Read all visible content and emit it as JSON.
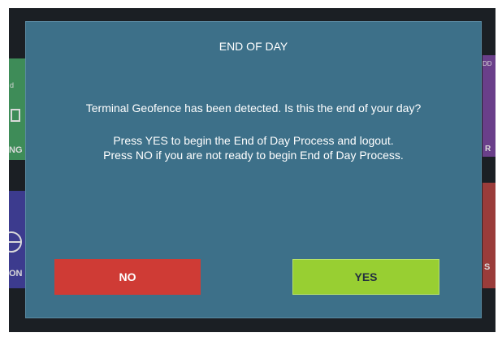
{
  "modal": {
    "title": "END OF DAY",
    "question": "Terminal Geofence has been detected. Is this the end of your day?",
    "instruction_yes": "Press YES to begin the End of Day Process and logout.",
    "instruction_no": "Press NO if you are not ready to begin End of Day Process.",
    "no_label": "NO",
    "yes_label": "YES"
  },
  "background_tiles": {
    "left_top_label": "NG",
    "left_top_small": "d",
    "left_bottom_label": "ON",
    "right_top_label": "DD",
    "right_top_small": "R",
    "right_bottom_label": "S"
  },
  "colors": {
    "modal_bg": "#3d7089",
    "no_button": "#cf3b35",
    "yes_button": "#98cf32"
  }
}
